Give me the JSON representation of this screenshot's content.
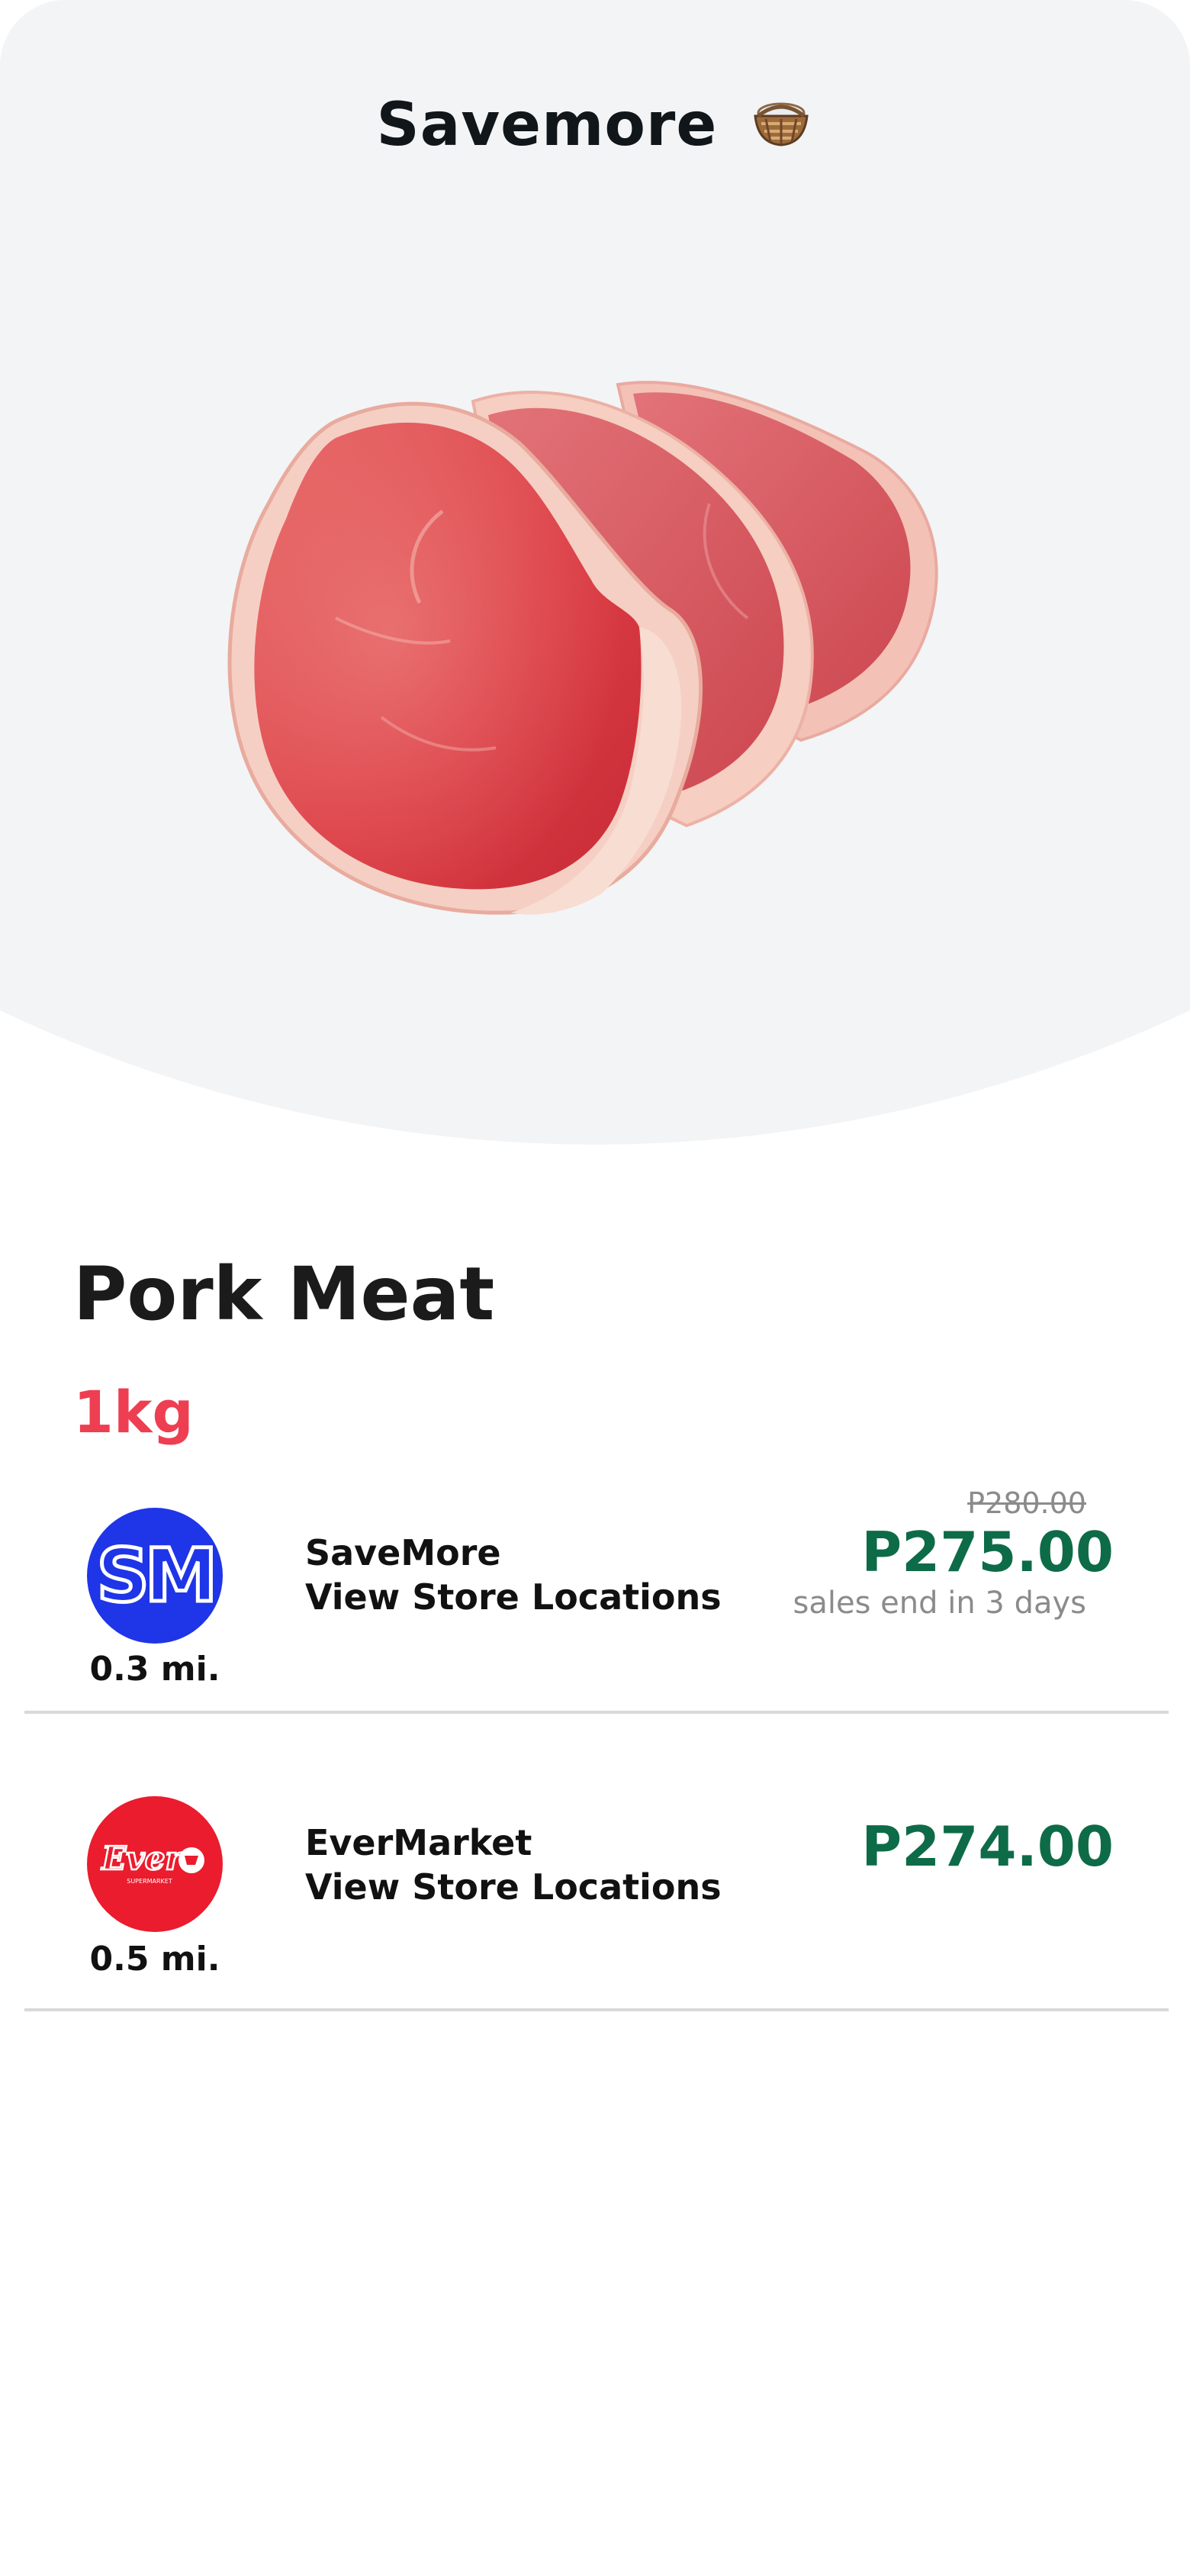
{
  "header": {
    "title": "Savemore",
    "icon": "basket-icon"
  },
  "product": {
    "image": "pork-meat-image",
    "name": "Pork Meat",
    "weight": "1kg"
  },
  "colors": {
    "weight": "#ee3e52",
    "price": "#0e6b48",
    "muted": "#8b8b8b",
    "hero_background": "#f3f4f6",
    "sm_logo": "#1f35e8",
    "ever_logo": "#ea1c2d"
  },
  "stores": [
    {
      "logo": "sm-logo",
      "logo_text": "SM",
      "distance": "0.3 mi.",
      "name": "SaveMore",
      "link": "View Store Locations",
      "old_price": "P280.00",
      "price": "P275.00",
      "sale_note": "sales end in 3 days"
    },
    {
      "logo": "ever-logo",
      "logo_text": "Ever",
      "logo_subtext": "SUPERMARKET",
      "distance": "0.5 mi.",
      "name": "EverMarket",
      "link": "View Store Locations",
      "price": "P274.00"
    }
  ]
}
